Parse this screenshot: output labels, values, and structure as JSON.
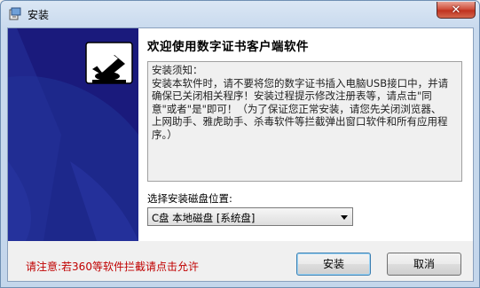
{
  "window": {
    "title": "安装",
    "close_label": "✕"
  },
  "content": {
    "heading": "欢迎使用数字证书客户端软件",
    "notice_text": "安装须知：\n安装本软件时，请不要将您的数字证书插入电脑USB接口中，并请确保已关闭相关程序！安装过程提示修改注册表等，请点击\"同意\"或者\"是\"即可！（为了保证您正常安装，请您先关闭浏览器、上网助手、雅虎助手、杀毒软件等拦截弹出窗口软件和所有应用程序。）",
    "drive_label": "选择安装磁盘位置:",
    "drive_selected": "C盘 本地磁盘 [系统盘]"
  },
  "footer": {
    "warning": "请注意:若360等软件拦截请点击允许",
    "install_label": "安装",
    "cancel_label": "取消"
  },
  "colors": {
    "banner": "#1a1a7c",
    "warning": "#c00000"
  }
}
